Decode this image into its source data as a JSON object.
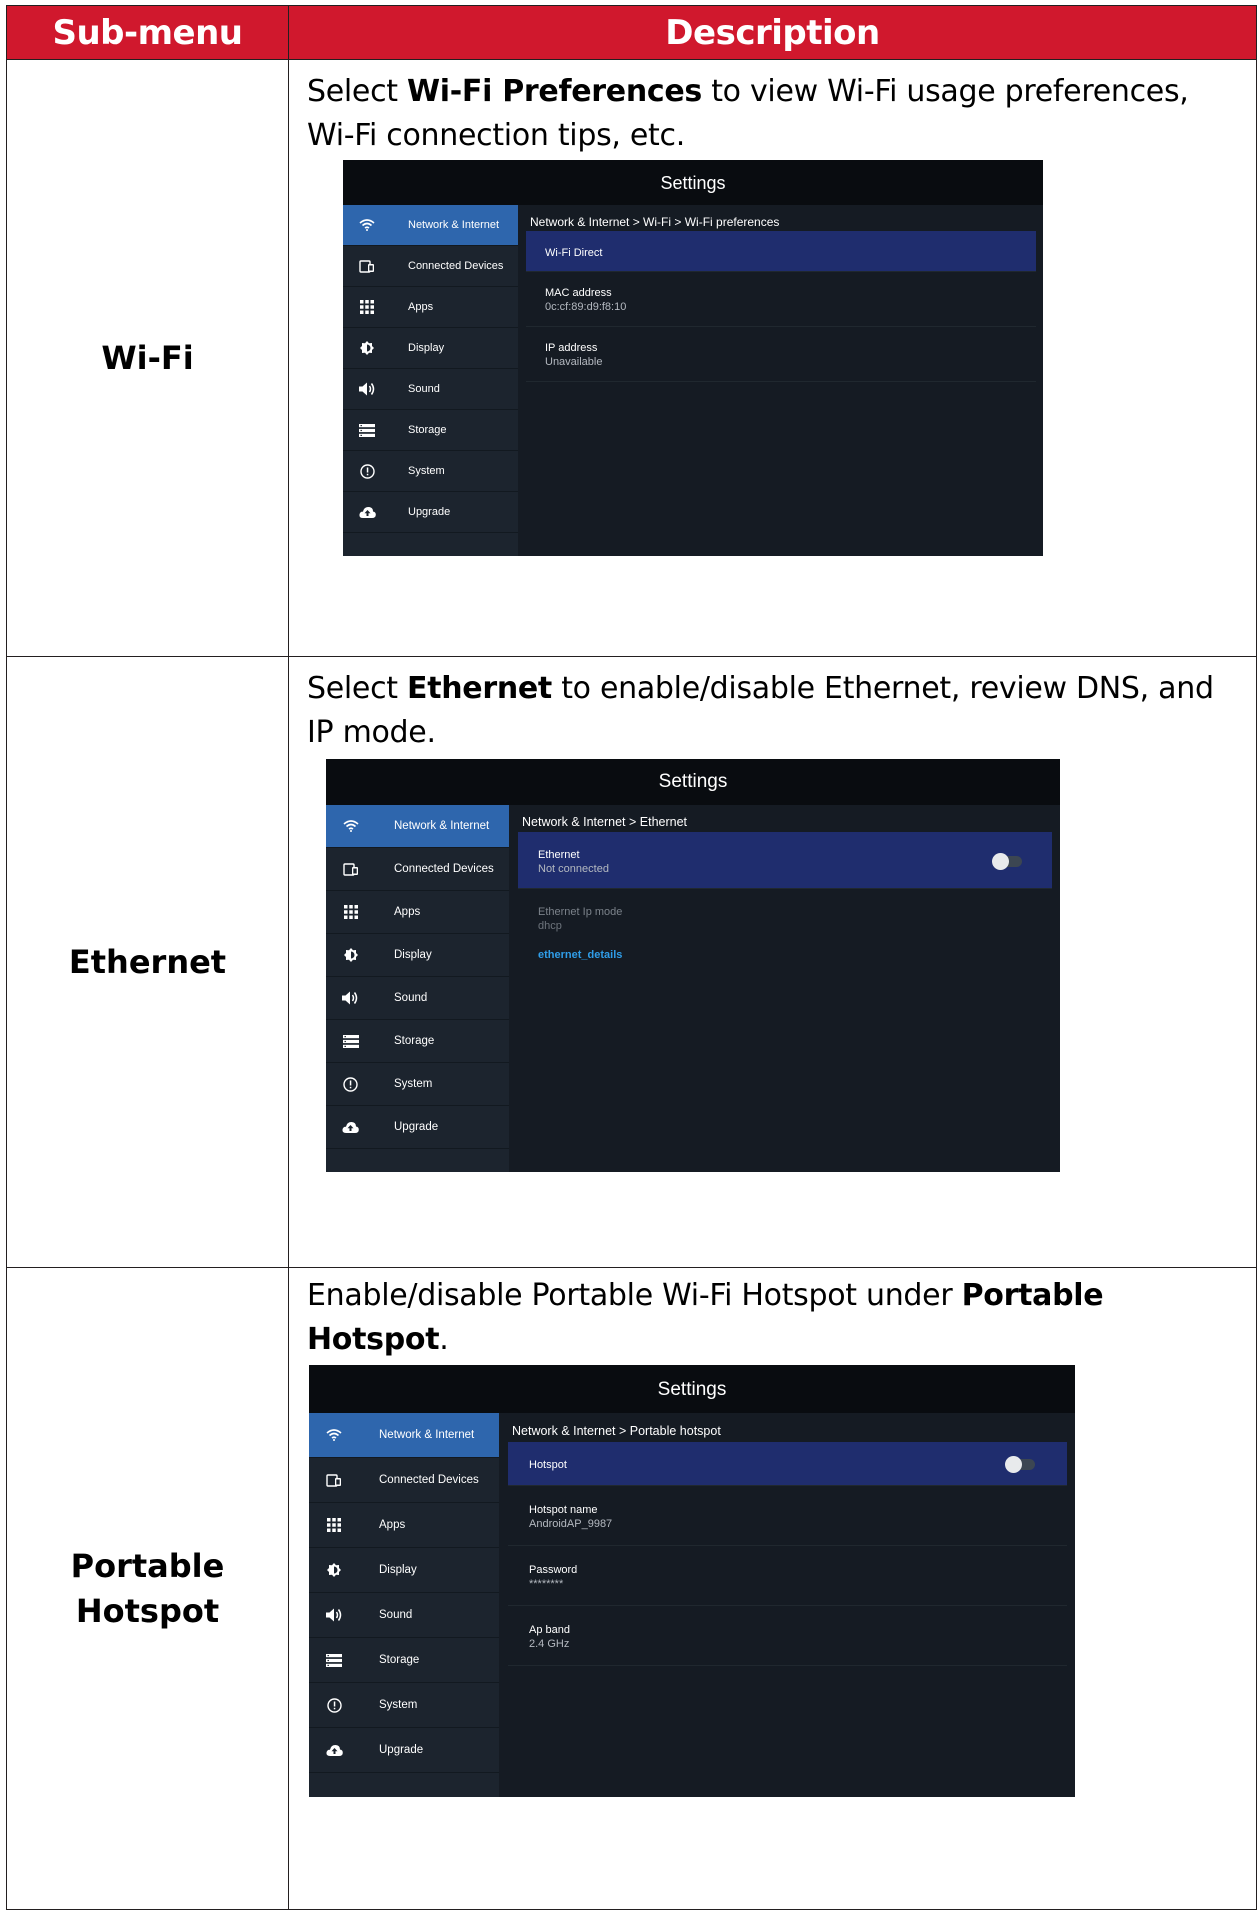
{
  "table": {
    "header_submenu": "Sub-menu",
    "header_description": "Description"
  },
  "rows": [
    {
      "submenu": "Wi-Fi",
      "desc_pre": "Select ",
      "desc_bold": "Wi-Fi Preferences",
      "desc_post": " to view Wi-Fi usage preferences, Wi-Fi connection tips, etc.",
      "screenshot": {
        "title": "Settings",
        "breadcrumb": "Network & Internet > Wi-Fi > Wi-Fi preferences",
        "items": [
          {
            "label": "Wi-Fi Direct",
            "value": ""
          },
          {
            "label": "MAC address",
            "value": "0c:cf:89:d9:f8:10"
          },
          {
            "label": "IP address",
            "value": "Unavailable"
          }
        ]
      }
    },
    {
      "submenu": "Ethernet",
      "desc_pre": "Select ",
      "desc_bold": "Ethernet",
      "desc_post": " to enable/disable Ethernet, review DNS, and IP mode.",
      "screenshot": {
        "title": "Settings",
        "breadcrumb": "Network & Internet > Ethernet",
        "items": [
          {
            "label": "Ethernet",
            "value": "Not connected",
            "toggle": "off"
          },
          {
            "label": "Ethernet Ip mode",
            "value": "dhcp"
          },
          {
            "label": "ethernet_details",
            "value": ""
          }
        ]
      }
    },
    {
      "submenu_line1": "Portable",
      "submenu_line2": "Hotspot",
      "desc_pre": "Enable/disable Portable Wi-Fi Hotspot under ",
      "desc_bold": "Portable Hotspot",
      "desc_post": ".",
      "screenshot": {
        "title": "Settings",
        "breadcrumb": "Network & Internet > Portable hotspot",
        "items": [
          {
            "label": "Hotspot",
            "value": "",
            "toggle": "off"
          },
          {
            "label": "Hotspot name",
            "value": "AndroidAP_9987"
          },
          {
            "label": "Password",
            "value": "********"
          },
          {
            "label": "Ap band",
            "value": "2.4 GHz"
          }
        ]
      }
    }
  ],
  "sidebar": [
    {
      "label": "Network & Internet",
      "icon": "wifi-icon",
      "active": true
    },
    {
      "label": "Connected Devices",
      "icon": "devices-icon"
    },
    {
      "label": "Apps",
      "icon": "apps-grid-icon"
    },
    {
      "label": "Display",
      "icon": "brightness-icon"
    },
    {
      "label": "Sound",
      "icon": "speaker-icon"
    },
    {
      "label": "Storage",
      "icon": "storage-icon"
    },
    {
      "label": "System",
      "icon": "info-circle-icon"
    },
    {
      "label": "Upgrade",
      "icon": "cloud-upload-icon"
    }
  ]
}
